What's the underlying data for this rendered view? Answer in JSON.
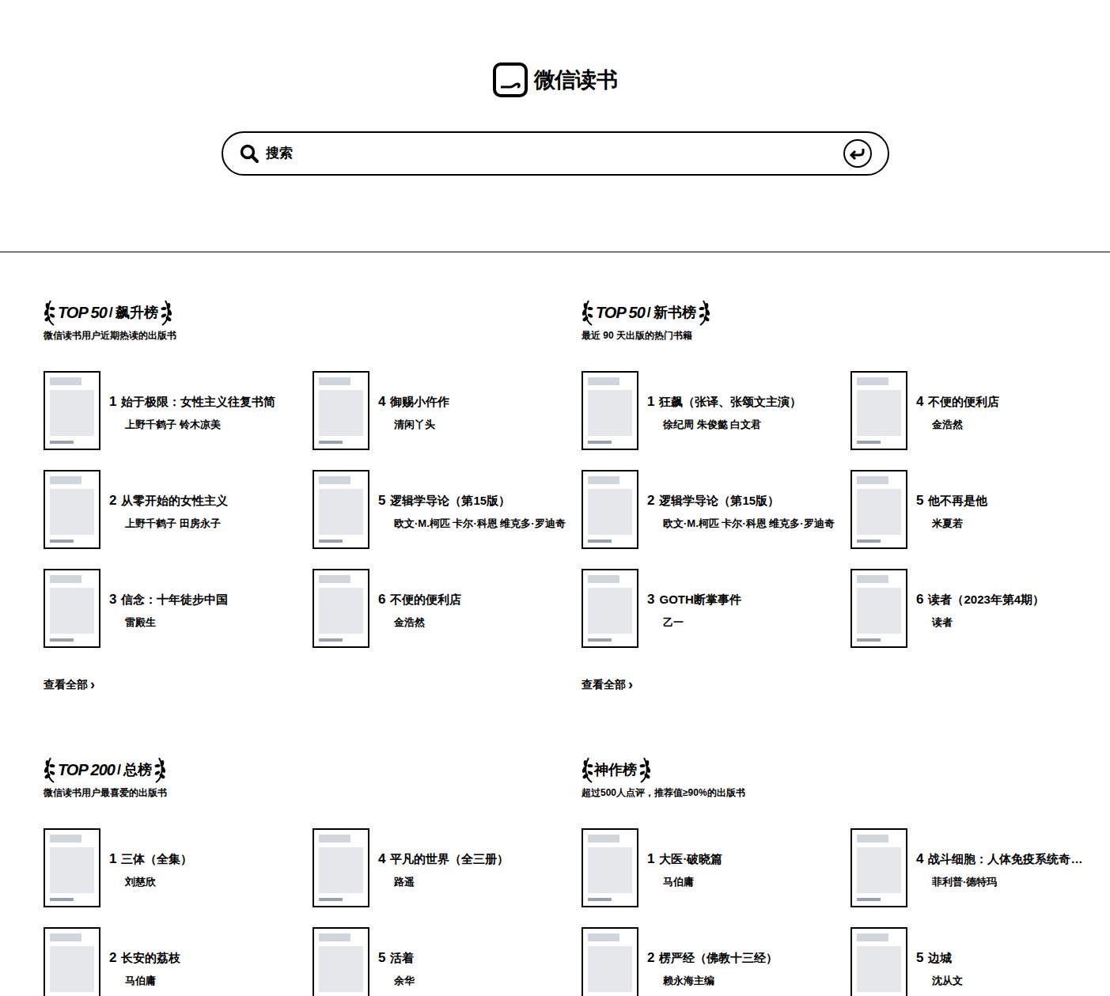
{
  "header": {
    "logo": "微信读书",
    "search": {
      "placeholder": "搜索"
    }
  },
  "sections": [
    {
      "badge": "TOP 50",
      "separator": "/",
      "title": "飙升榜",
      "subtitle": "微信读书用户近期热读的出版书",
      "books": [
        {
          "rank": "1",
          "title": "始于极限：女性主义往复书简",
          "author": "上野千鹤子 铃木凉美"
        },
        {
          "rank": "2",
          "title": "从零开始的女性主义",
          "author": "上野千鹤子 田房永子"
        },
        {
          "rank": "3",
          "title": "信念：十年徒步中国",
          "author": "雷殿生"
        },
        {
          "rank": "4",
          "title": "御赐小仵作",
          "author": "清闲丫头"
        },
        {
          "rank": "5",
          "title": "逻辑学导论（第15版）",
          "author": "欧文·M.柯匹 卡尔·科恩 维克多·罗迪奇"
        },
        {
          "rank": "6",
          "title": "不便的便利店",
          "author": "金浩然"
        }
      ],
      "more": "查看全部",
      "more_icon": "›"
    },
    {
      "badge": "TOP 50",
      "separator": "/",
      "title": "新书榜",
      "subtitle": "最近 90 天出版的热门书籍",
      "books": [
        {
          "rank": "1",
          "title": "狂飙（张译、张颂文主演）",
          "author": "徐纪周 朱俊懿 白文君"
        },
        {
          "rank": "2",
          "title": "逻辑学导论（第15版）",
          "author": "欧文·M.柯匹 卡尔·科恩 维克多·罗迪奇"
        },
        {
          "rank": "3",
          "title": "GOTH断掌事件",
          "author": "乙一"
        },
        {
          "rank": "4",
          "title": "不便的便利店",
          "author": "金浩然"
        },
        {
          "rank": "5",
          "title": "他不再是他",
          "author": "米夏若"
        },
        {
          "rank": "6",
          "title": "读者（2023年第4期）",
          "author": "读者"
        }
      ],
      "more": "查看全部",
      "more_icon": "›"
    },
    {
      "badge": "TOP 200",
      "separator": "/",
      "title": "总榜",
      "subtitle": "微信读书用户最喜爱的出版书",
      "books": [
        {
          "rank": "1",
          "title": "三体（全集）",
          "author": "刘慈欣"
        },
        {
          "rank": "2",
          "title": "长安的荔枝",
          "author": "马伯庸"
        },
        {
          "rank": "4",
          "title": "平凡的世界（全三册）",
          "author": "路遥"
        },
        {
          "rank": "5",
          "title": "活着",
          "author": "余华"
        }
      ]
    },
    {
      "title": "神作榜",
      "subtitle": "超过500人点评，推荐值≥90%的出版书",
      "books": [
        {
          "rank": "1",
          "title": "大医·破晓篇",
          "author": "马伯庸"
        },
        {
          "rank": "2",
          "title": "楞严经（佛教十三经）",
          "author": "赖永海主编"
        },
        {
          "rank": "4",
          "title": "战斗细胞：人体免疫系统奇…",
          "author": "菲利普·德特玛"
        },
        {
          "rank": "5",
          "title": "边城",
          "author": "沈从文"
        }
      ]
    }
  ]
}
